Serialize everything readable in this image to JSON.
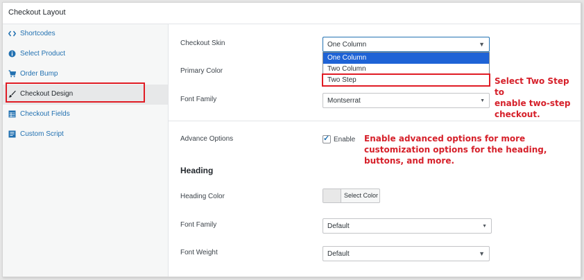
{
  "header": {
    "title": "Checkout Layout"
  },
  "sidebar": {
    "items": [
      {
        "label": "Shortcodes",
        "icon": "code-icon"
      },
      {
        "label": "Select Product",
        "icon": "info-icon"
      },
      {
        "label": "Order Bump",
        "icon": "cart-icon"
      },
      {
        "label": "Checkout Design",
        "icon": "brush-icon",
        "active": true
      },
      {
        "label": "Checkout Fields",
        "icon": "table-icon"
      },
      {
        "label": "Custom Script",
        "icon": "document-icon"
      }
    ]
  },
  "form": {
    "checkout_skin": {
      "label": "Checkout Skin",
      "value": "One Column",
      "options": [
        "One Column",
        "Two Column",
        "Two Step"
      ]
    },
    "primary_color": {
      "label": "Primary Color"
    },
    "font_family": {
      "label": "Font Family",
      "value": "Montserrat"
    },
    "advance_options": {
      "label": "Advance Options",
      "checkbox_label": "Enable",
      "checked": true
    },
    "heading": {
      "title": "Heading",
      "color": {
        "label": "Heading Color",
        "button": "Select Color"
      },
      "font_family": {
        "label": "Font Family",
        "value": "Default"
      },
      "font_weight": {
        "label": "Font Weight",
        "value": "Default"
      }
    }
  },
  "annotations": {
    "two_step": [
      "Select Two Step to",
      "enable two-step",
      "checkout."
    ],
    "advanced": [
      "Enable advanced options for more",
      "customization options for the heading,",
      "buttons, and more."
    ]
  },
  "colors": {
    "highlight": "#e01b24",
    "accent": "#2271b1",
    "selected_option": "#1e63d6"
  }
}
